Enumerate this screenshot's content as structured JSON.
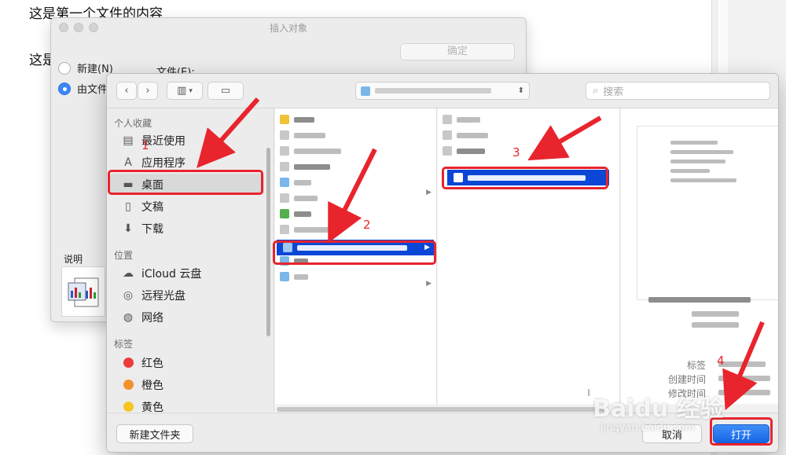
{
  "document": {
    "line1": "这是第一个文件的内容",
    "line2": "这是"
  },
  "insert_dialog": {
    "title": "插入对象",
    "ok_label": "确定",
    "option_new": "新建(N)",
    "option_from_file": "由文件",
    "file_label": "文件(E):",
    "description_label": "说明"
  },
  "open_dialog": {
    "search_placeholder": "搜索",
    "sidebar": {
      "favorites_header": "个人收藏",
      "favorites": [
        {
          "label": "最近使用",
          "icon": "recents-icon"
        },
        {
          "label": "应用程序",
          "icon": "applications-icon"
        },
        {
          "label": "桌面",
          "icon": "desktop-icon"
        },
        {
          "label": "文稿",
          "icon": "documents-icon"
        },
        {
          "label": "下载",
          "icon": "downloads-icon"
        }
      ],
      "locations_header": "位置",
      "locations": [
        {
          "label": "iCloud 云盘",
          "icon": "cloud-icon"
        },
        {
          "label": "远程光盘",
          "icon": "disc-icon"
        },
        {
          "label": "网络",
          "icon": "network-icon"
        }
      ],
      "tags_header": "标签",
      "tags": [
        {
          "label": "红色",
          "color": "#ec3b3b"
        },
        {
          "label": "橙色",
          "color": "#f3922b"
        },
        {
          "label": "黄色",
          "color": "#f5c525"
        }
      ]
    },
    "preview_info": {
      "tags_label": "标签",
      "created_label": "创建时间",
      "modified_label": "修改时间"
    },
    "new_folder_label": "新建文件夹",
    "cancel_label": "取消",
    "open_label": "打开"
  },
  "annotations": {
    "step1": "1",
    "step2": "2",
    "step3": "3",
    "step4": "4",
    "accent_color": "#e8242d"
  },
  "watermark": {
    "brand": "Baidu 经验",
    "url": "jingyan.baidu.com"
  }
}
